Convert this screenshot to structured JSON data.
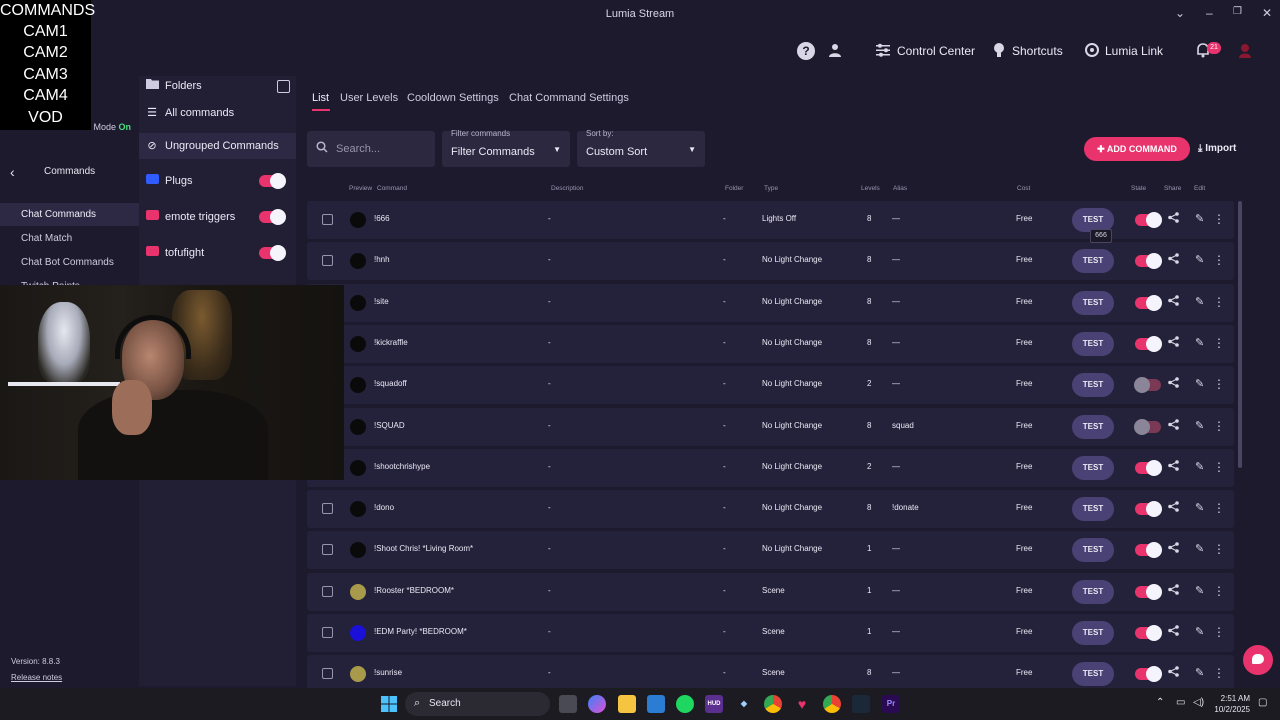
{
  "window": {
    "title": "Lumia Stream"
  },
  "overlay": {
    "lines": [
      "COMMANDS",
      "CAM1",
      "CAM2",
      "CAM3",
      "CAM4",
      "VOD"
    ]
  },
  "stream_mode": {
    "label": "Stream Mode",
    "state": "On"
  },
  "topbar": {
    "control_center": "Control Center",
    "shortcuts": "Shortcuts",
    "lumia_link": "Lumia Link",
    "notification_count": "21"
  },
  "leftnav": {
    "title": "Commands",
    "items": [
      "Chat Commands",
      "Chat Match",
      "Chat Bot Commands",
      "Twitch Points"
    ],
    "active": "Chat Commands",
    "version": "Version: 8.8.3",
    "release_notes": "Release notes"
  },
  "folders": {
    "header": "Folders",
    "all_commands": "All commands",
    "ungrouped": "Ungrouped Commands",
    "items": [
      {
        "label": "Plugs",
        "color": "#2f5bff",
        "enabled": true
      },
      {
        "label": "emote triggers",
        "color": "#e8336d",
        "enabled": true
      },
      {
        "label": "tofufight",
        "color": "#e8336d",
        "enabled": true
      }
    ]
  },
  "tabs": [
    "List",
    "User Levels",
    "Cooldown Settings",
    "Chat Command Settings"
  ],
  "active_tab": "List",
  "search": {
    "placeholder": "Search..."
  },
  "filter": {
    "label": "Filter commands",
    "value": "Filter Commands"
  },
  "sort": {
    "label": "Sort by:",
    "value": "Custom Sort"
  },
  "actions": {
    "add_command": "ADD COMMAND",
    "import": "Import"
  },
  "columns": {
    "preview": "Preview",
    "command": "Command",
    "description": "Description",
    "folder": "Folder",
    "type": "Type",
    "levels": "Levels",
    "alias": "Alias",
    "cost": "Cost",
    "state": "State",
    "share": "Share",
    "edit": "Edit"
  },
  "rows": [
    {
      "command": "!666",
      "description": "-",
      "folder": "-",
      "type": "Lights Off",
      "levels": "8",
      "alias": "—",
      "cost": "Free",
      "test": "TEST",
      "enabled": true,
      "color": "#0a0a0a"
    },
    {
      "command": "!hnh",
      "description": "-",
      "folder": "-",
      "type": "No Light Change",
      "levels": "8",
      "alias": "—",
      "cost": "Free",
      "test": "TEST",
      "enabled": true,
      "color": "#0a0a0a"
    },
    {
      "command": "!site",
      "description": "-",
      "folder": "-",
      "type": "No Light Change",
      "levels": "8",
      "alias": "—",
      "cost": "Free",
      "test": "TEST",
      "enabled": true,
      "color": "#0a0a0a"
    },
    {
      "command": "!kickraffle",
      "description": "-",
      "folder": "-",
      "type": "No Light Change",
      "levels": "8",
      "alias": "—",
      "cost": "Free",
      "test": "TEST",
      "enabled": true,
      "color": "#0a0a0a"
    },
    {
      "command": "!squadoff",
      "description": "-",
      "folder": "-",
      "type": "No Light Change",
      "levels": "2",
      "alias": "—",
      "cost": "Free",
      "test": "TEST",
      "enabled": false,
      "color": "#0a0a0a"
    },
    {
      "command": "!SQUAD",
      "description": "-",
      "folder": "-",
      "type": "No Light Change",
      "levels": "8",
      "alias": "squad",
      "cost": "Free",
      "test": "TEST",
      "enabled": false,
      "color": "#0a0a0a"
    },
    {
      "command": "!shootchrishype",
      "description": "-",
      "folder": "-",
      "type": "No Light Change",
      "levels": "2",
      "alias": "—",
      "cost": "Free",
      "test": "TEST",
      "enabled": true,
      "color": "#0a0a0a"
    },
    {
      "command": "!dono",
      "description": "-",
      "folder": "-",
      "type": "No Light Change",
      "levels": "8",
      "alias": "!donate",
      "cost": "Free",
      "test": "TEST",
      "enabled": true,
      "color": "#0a0a0a"
    },
    {
      "command": "!Shoot Chris! *Living Room*",
      "description": "-",
      "folder": "-",
      "type": "No Light Change",
      "levels": "1",
      "alias": "—",
      "cost": "Free",
      "test": "TEST",
      "enabled": true,
      "color": "#0a0a0a"
    },
    {
      "command": "!Rooster *BEDROOM*",
      "description": "-",
      "folder": "-",
      "type": "Scene",
      "levels": "1",
      "alias": "—",
      "cost": "Free",
      "test": "TEST",
      "enabled": true,
      "color": "#a79a4a"
    },
    {
      "command": "!EDM Party! *BEDROOM*",
      "description": "-",
      "folder": "-",
      "type": "Scene",
      "levels": "1",
      "alias": "—",
      "cost": "Free",
      "test": "TEST",
      "enabled": true,
      "color": "#1a10d8"
    },
    {
      "command": "!sunrise",
      "description": "-",
      "folder": "-",
      "type": "Scene",
      "levels": "8",
      "alias": "—",
      "cost": "Free",
      "test": "TEST",
      "enabled": true,
      "color": "#a79a4a"
    }
  ],
  "tooltip": "666",
  "taskbar": {
    "search": "Search",
    "time": "2:51 AM",
    "date": "10/2/2025"
  }
}
